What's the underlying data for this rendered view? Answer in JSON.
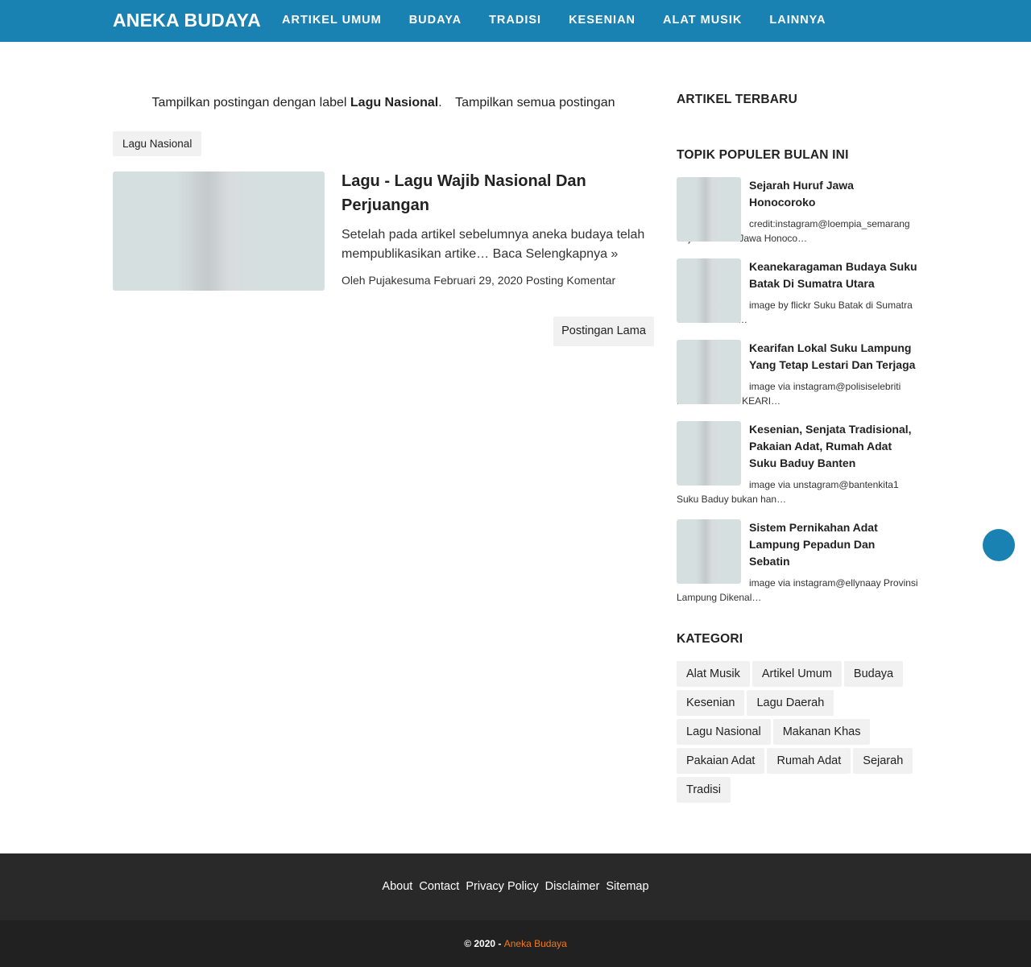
{
  "header": {
    "brand": "ANEKA BUDAYA",
    "nav": [
      "ARTIKEL UMUM",
      "BUDAYA",
      "TRADISI",
      "KESENIAN",
      "ALAT MUSIK",
      "LAINNYA"
    ],
    "accent_color": "#1a82b2"
  },
  "label_info": {
    "prefix": "Tampilkan postingan dengan label",
    "label": "Lagu Nasional",
    "suffix": ".",
    "show_all": "Tampilkan semua postingan"
  },
  "label_chip": "Lagu Nasional",
  "post": {
    "title": "Lagu - Lagu Wajib Nasional Dan Perjuangan",
    "snippet": "Setelah pada artikel sebelumnya aneka budaya telah mempublikasikan artike…",
    "read_more": "Baca Selengkapnya »",
    "author_prefix": "Oleh",
    "author": "Pujakesuma",
    "date": "Februari 29, 2020",
    "comment": "Posting Komentar"
  },
  "older_posts": "Postingan Lama",
  "sidebar": {
    "latest_heading": "ARTIKEL TERBARU",
    "popular_heading": "TOPIK POPULER BULAN INI",
    "popular": [
      {
        "title": "Sejarah Huruf Jawa Honocoroko",
        "snippet": "credit:instagram@loempia_semarang Sejarah Huruf Jawa Honoco…"
      },
      {
        "title": "Keanekaragaman Budaya Suku Batak Di Sumatra Utara",
        "snippet": "image by flickr Suku Batak di Sumatra Utara memiliki…"
      },
      {
        "title": "Kearifan Lokal Suku Lampung Yang Tetap Lestari Dan Terjaga",
        "snippet": "image via instagram@polisiselebriti PENGERTIAN KEARI…"
      },
      {
        "title": "Kesenian, Senjata Tradisional, Pakaian Adat, Rumah Adat Suku Baduy Banten",
        "snippet": "image via unstagram@bantenkita1 Suku Baduy bukan han…"
      },
      {
        "title": "Sistem Pernikahan Adat Lampung Pepadun Dan Sebatin",
        "snippet": "image via instagram@ellynaay Provinsi Lampung Dikenal…"
      }
    ],
    "category_heading": "KATEGORI",
    "categories": [
      "Alat Musik",
      "Artikel Umum",
      "Budaya",
      "Kesenian",
      "Lagu Daerah",
      "Lagu Nasional",
      "Makanan Khas",
      "Pakaian Adat",
      "Rumah Adat",
      "Sejarah",
      "Tradisi"
    ]
  },
  "footer": {
    "links": [
      "About",
      "Contact",
      "Privacy Policy",
      "Disclaimer",
      "Sitemap"
    ],
    "copyright_prefix": "© 2020 -",
    "copyright_site": "Aneka Budaya"
  }
}
